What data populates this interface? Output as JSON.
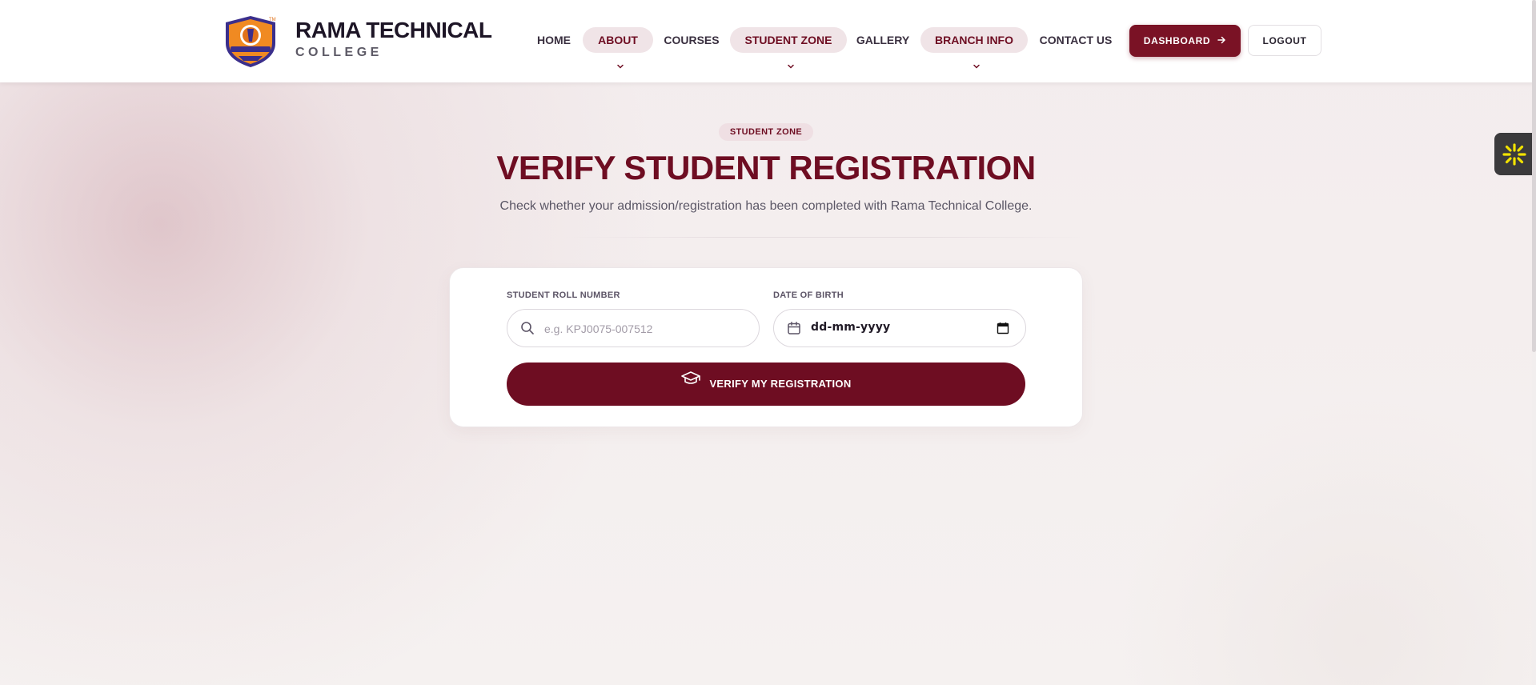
{
  "brand": {
    "title": "RAMA TECHNICAL",
    "subtitle": "COLLEGE",
    "logo_icon": "college-crest-icon"
  },
  "nav": {
    "items": [
      {
        "label": "HOME",
        "dropdown": false
      },
      {
        "label": "ABOUT",
        "dropdown": true
      },
      {
        "label": "COURSES",
        "dropdown": false
      },
      {
        "label": "STUDENT ZONE",
        "dropdown": true
      },
      {
        "label": "GALLERY",
        "dropdown": false
      },
      {
        "label": "BRANCH INFO",
        "dropdown": true
      },
      {
        "label": "CONTACT US",
        "dropdown": false
      }
    ],
    "dashboard_label": "DASHBOARD",
    "logout_label": "LOGOUT"
  },
  "hero": {
    "eyebrow": "STUDENT ZONE",
    "title": "VERIFY STUDENT REGISTRATION",
    "subtitle": "Check whether your admission/registration has been completed with Rama Technical College."
  },
  "form": {
    "roll_label": "STUDENT ROLL NUMBER",
    "roll_placeholder": "e.g. KPJ0075-007512",
    "roll_value": "",
    "dob_label": "DATE OF BIRTH",
    "dob_placeholder": "dd-mm-yyyy",
    "submit_label": "VERIFY MY REGISTRATION",
    "submit_icon": "graduation-cap-icon"
  },
  "colors": {
    "primary": "#6e0d22",
    "pill_bg": "#f0e4e7",
    "text_dark": "#1d1526"
  }
}
